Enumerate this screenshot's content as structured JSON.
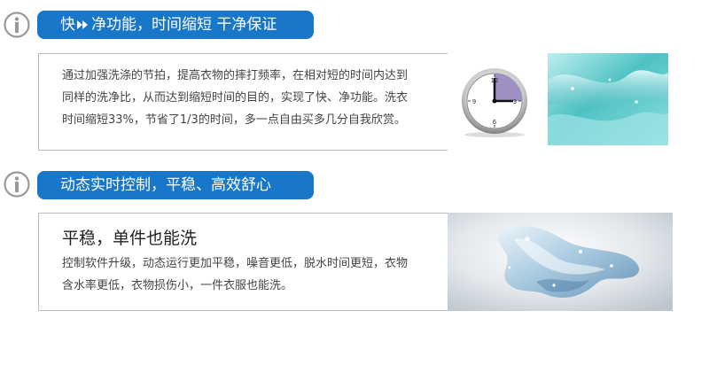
{
  "section1": {
    "title_part1": "快",
    "title_part2": "净功能，时间缩短 干净保证",
    "paragraph": [
      "通过加强洗涤的节拍，提高衣物的摔打频率，在相对短的时间内达到",
      "同样的洗净比，从而达到缩短时间的目的，实现了快、净功能。洗衣",
      "时间缩短33%，节省了1/3的时间，多一点自由买多几分自我欣赏。"
    ]
  },
  "section2": {
    "title": "动态实时控制，平稳、高效舒心",
    "heading": "平稳，单件也能洗",
    "paragraph": [
      "控制软件升级，动态运行更加平稳，噪音更低，脱水时间更短，衣物",
      "含水率更低，衣物损伤小，一件衣服也能洗。"
    ]
  },
  "clock": {
    "numerals": [
      "12",
      "3",
      "6",
      "9"
    ]
  },
  "colors": {
    "pill": "#1877c9",
    "icon": "#9a9a9a",
    "water": "#5fc9c8",
    "clock_sector": "#9f8fc4"
  },
  "icons": [
    "info-icon",
    "double-arrow-icon",
    "clock-icon"
  ]
}
